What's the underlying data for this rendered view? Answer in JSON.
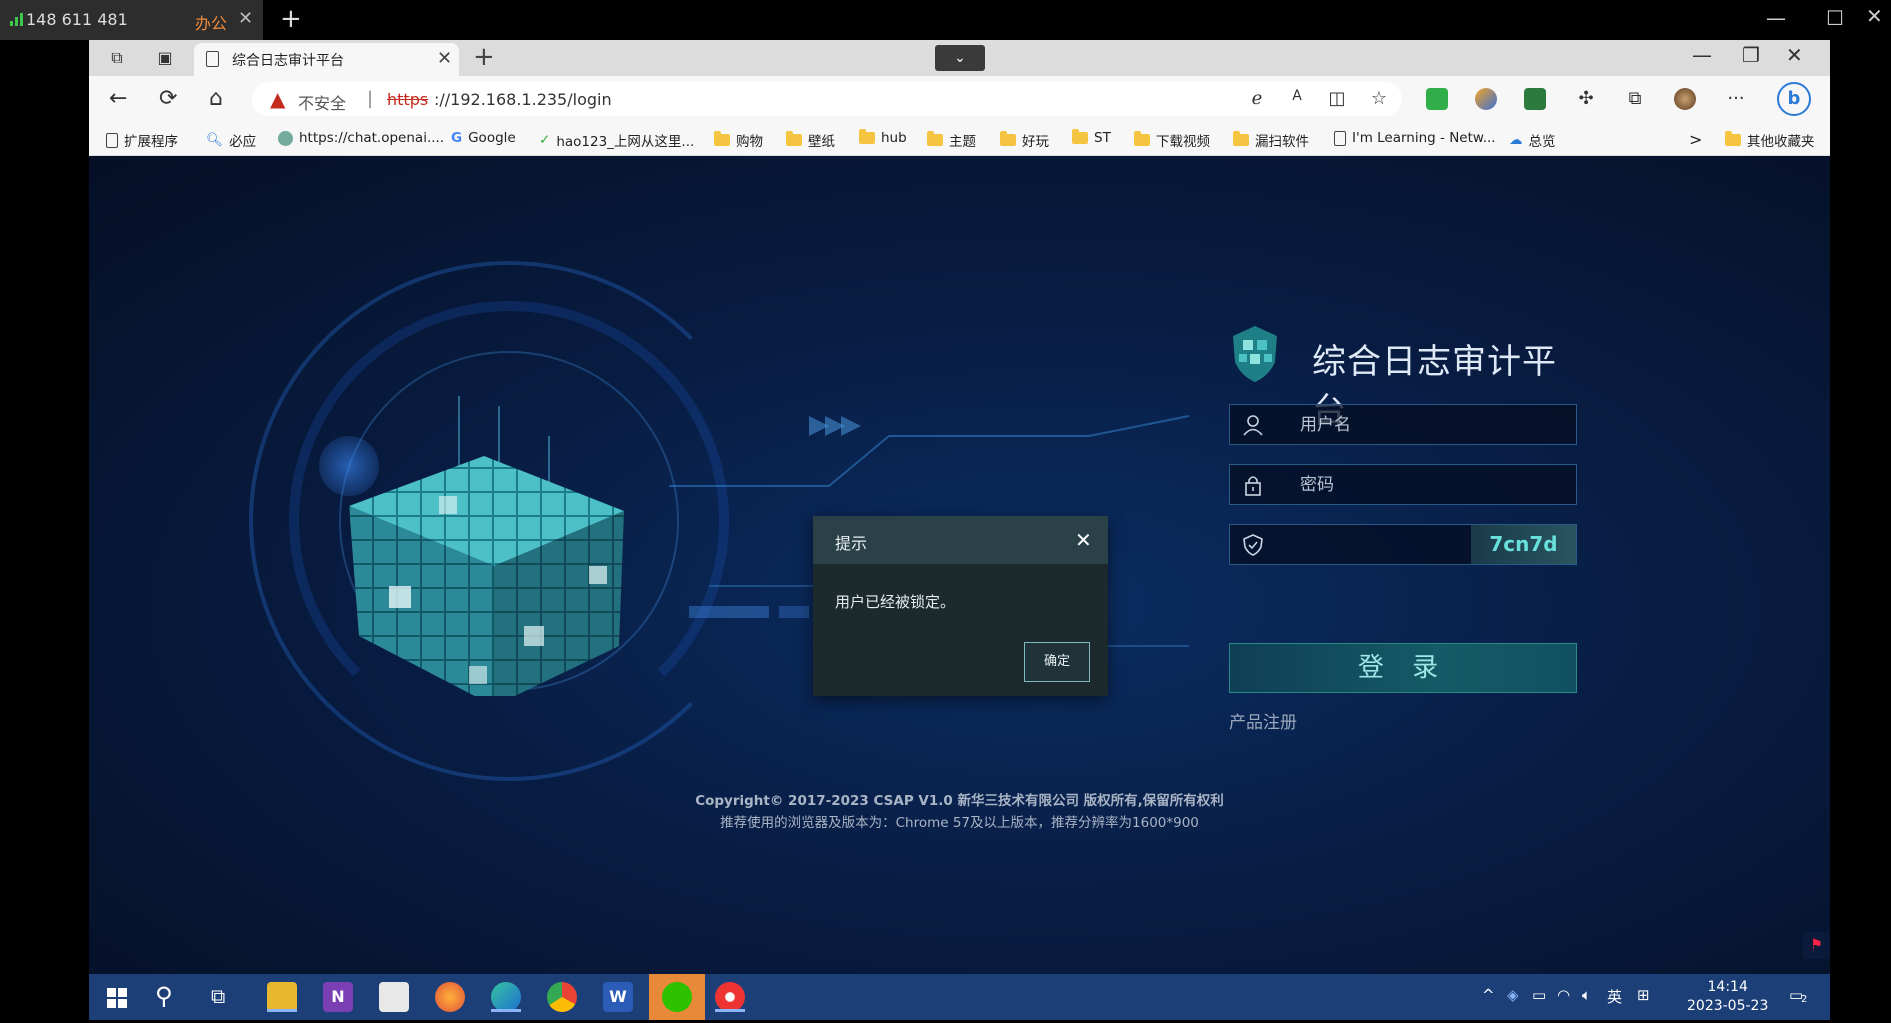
{
  "outer": {
    "tab_number": "148 611 481",
    "tab_label": "办公",
    "close": "✕",
    "plus": "+",
    "minimize": "—",
    "maximize": "☐",
    "close_window": "✕"
  },
  "browser": {
    "tab_title": "综合日志审计平台",
    "tab_close": "✕",
    "new_tab": "+",
    "tab_search": "⌄",
    "win_minimize": "—",
    "win_restore": "❐",
    "win_close": "✕"
  },
  "address": {
    "security_label": "不安全",
    "separator": "|",
    "protocol": "https",
    "host": "://192.168.1.235/login",
    "back": "←",
    "refresh": "⟳",
    "home": "⌂",
    "more": "···"
  },
  "bookmarks": [
    {
      "label": "扩展程序",
      "icon": "page-icon"
    },
    {
      "label": "必应",
      "icon": "search-icon"
    },
    {
      "label": "https://chat.openai....",
      "icon": "openai-icon"
    },
    {
      "label": "Google",
      "icon": "google-icon"
    },
    {
      "label": "hao123_上网从这里...",
      "icon": "hao123-icon"
    },
    {
      "label": "购物",
      "icon": "folder-icon"
    },
    {
      "label": "壁纸",
      "icon": "folder-icon"
    },
    {
      "label": "hub",
      "icon": "folder-icon"
    },
    {
      "label": "主题",
      "icon": "folder-icon"
    },
    {
      "label": "好玩",
      "icon": "folder-icon"
    },
    {
      "label": "ST",
      "icon": "folder-icon"
    },
    {
      "label": "下载视频",
      "icon": "folder-icon"
    },
    {
      "label": "漏扫软件",
      "icon": "folder-icon"
    },
    {
      "label": "I'm Learning - Netw...",
      "icon": "page-icon"
    },
    {
      "label": "总览",
      "icon": "cloud-icon"
    },
    {
      "label": "其他收藏夹",
      "icon": "folder-icon"
    }
  ],
  "bookmarks_more": ">",
  "login": {
    "platform_name": "综合日志审计平台",
    "username_placeholder": "用户名",
    "password_placeholder": "密码",
    "captcha_text": "7cn7d",
    "login_button": "登 录",
    "register_link": "产品注册",
    "copyright": "Copyright© 2017-2023 CSAP V1.0 新华三技术有限公司 版权所有,保留所有权利",
    "recommend": "推荐使用的浏览器及版本为：Chrome 57及以上版本，推荐分辨率为1600*900",
    "side_flag": "⚑"
  },
  "dialog": {
    "title": "提示",
    "close": "✕",
    "message": "用户已经被锁定。",
    "ok_button": "确定"
  },
  "taskbar": {
    "tray_caret": "^",
    "ime": "英",
    "time": "14:14",
    "date": "2023-05-23",
    "notification_count": "2"
  },
  "colors": {
    "accent_teal": "#2a8a8a",
    "danger": "#c42b1c",
    "dialog_bg": "#1c2a2e",
    "taskbar": "#1c3f77"
  }
}
